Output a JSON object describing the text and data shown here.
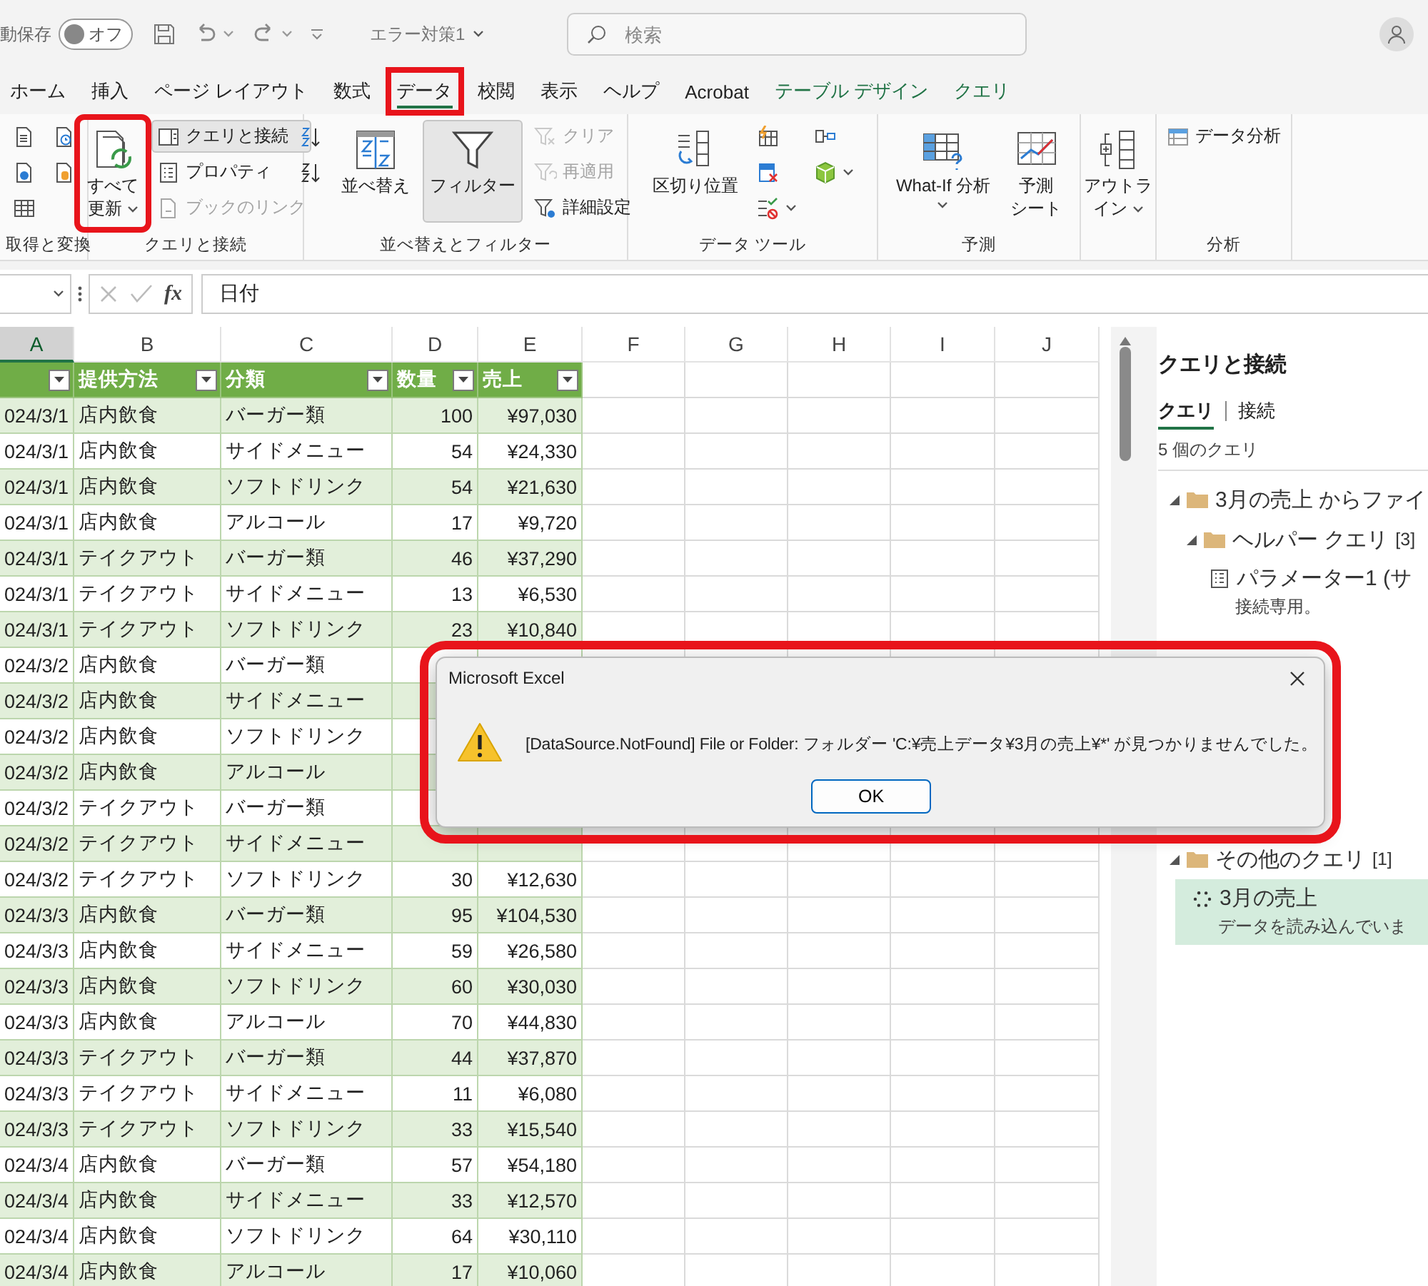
{
  "title_bar": {
    "autosave_label": "動保存",
    "autosave": {
      "on": false,
      "label": "オフ"
    },
    "file_name": "エラー対策1",
    "search": {
      "placeholder": "検索"
    }
  },
  "tabs": [
    {
      "label": "ホーム",
      "kind": "standard",
      "selected": false,
      "highlighted": false
    },
    {
      "label": "挿入",
      "kind": "standard",
      "selected": false,
      "highlighted": false
    },
    {
      "label": "ページ レイアウト",
      "kind": "standard",
      "selected": false,
      "highlighted": false
    },
    {
      "label": "数式",
      "kind": "standard",
      "selected": false,
      "highlighted": false
    },
    {
      "label": "データ",
      "kind": "standard",
      "selected": true,
      "highlighted": true
    },
    {
      "label": "校閲",
      "kind": "standard",
      "selected": false,
      "highlighted": false
    },
    {
      "label": "表示",
      "kind": "standard",
      "selected": false,
      "highlighted": false
    },
    {
      "label": "ヘルプ",
      "kind": "standard",
      "selected": false,
      "highlighted": false
    },
    {
      "label": "Acrobat",
      "kind": "standard",
      "selected": false,
      "highlighted": false
    },
    {
      "label": "テーブル デザイン",
      "kind": "contextual",
      "selected": false,
      "highlighted": false
    },
    {
      "label": "クエリ",
      "kind": "contextual",
      "selected": false,
      "highlighted": false
    }
  ],
  "ribbon": {
    "groups": [
      {
        "kind": "get",
        "label": "取得と変換",
        "buttons": [
          {
            "kind": "small",
            "disabled": false,
            "pressed": false
          },
          {
            "kind": "small",
            "disabled": false,
            "pressed": false
          },
          {
            "kind": "small",
            "disabled": false,
            "pressed": false
          },
          {
            "kind": "small",
            "disabled": false,
            "pressed": false
          },
          {
            "kind": "small",
            "disabled": false,
            "pressed": false
          }
        ]
      },
      {
        "kind": "queries",
        "label": "クエリと接続",
        "buttons": [
          {
            "kind": "large",
            "lines": [
              "すべて",
              "更新"
            ],
            "disabled": false,
            "pressed": false,
            "dropdown": true,
            "highlighted": true
          },
          {
            "kind": "small",
            "label": "クエリと接続",
            "disabled": false,
            "pressed": true
          },
          {
            "kind": "small",
            "label": "プロパティ",
            "disabled": false,
            "pressed": false
          },
          {
            "kind": "small",
            "label": "ブックのリンク",
            "disabled": true,
            "pressed": false
          }
        ]
      },
      {
        "kind": "sort",
        "label": "並べ替えとフィルター",
        "buttons": [
          {
            "kind": "small",
            "disabled": false,
            "pressed": false
          },
          {
            "kind": "small",
            "disabled": false,
            "pressed": false
          },
          {
            "kind": "large",
            "lines": [
              "並べ替え"
            ],
            "disabled": false,
            "pressed": false
          },
          {
            "kind": "large",
            "lines": [
              "フィルター"
            ],
            "disabled": false,
            "pressed": true
          },
          {
            "kind": "small",
            "label": "クリア",
            "disabled": true,
            "pressed": false
          },
          {
            "kind": "small",
            "label": "再適用",
            "disabled": true,
            "pressed": false
          },
          {
            "kind": "small",
            "label": "詳細設定",
            "disabled": false,
            "pressed": false
          }
        ]
      },
      {
        "kind": "tools",
        "label": "データ ツール",
        "buttons": [
          {
            "kind": "large",
            "lines": [
              "区切り位置"
            ],
            "disabled": false,
            "pressed": false
          },
          {
            "kind": "small",
            "disabled": false,
            "pressed": false
          },
          {
            "kind": "small",
            "disabled": false,
            "pressed": false
          },
          {
            "kind": "small",
            "disabled": false,
            "pressed": false,
            "dropdown": true
          },
          {
            "kind": "small",
            "disabled": false,
            "pressed": false
          },
          {
            "kind": "small",
            "disabled": false,
            "pressed": false,
            "dropdown": true
          }
        ]
      },
      {
        "kind": "forecast",
        "label": "予測",
        "buttons": [
          {
            "kind": "large",
            "lines": [
              "What-If 分析"
            ],
            "disabled": false,
            "pressed": false,
            "dropdown": true
          },
          {
            "kind": "large",
            "lines": [
              "予測",
              "シート"
            ],
            "disabled": false,
            "pressed": false
          }
        ]
      },
      {
        "kind": "outline",
        "buttons": [
          {
            "kind": "large",
            "lines": [
              "アウトラ",
              "イン"
            ],
            "disabled": false,
            "pressed": false,
            "dropdown": true
          }
        ]
      },
      {
        "kind": "analysis",
        "label": "分析",
        "buttons": [
          {
            "kind": "small",
            "label": "データ分析",
            "disabled": false,
            "pressed": false
          }
        ]
      }
    ]
  },
  "formula_bar": {
    "function_label": "fx",
    "value": "日付"
  },
  "sheet": {
    "column_headers": [
      {
        "letter": "A",
        "selected": true
      },
      {
        "letter": "B",
        "selected": false
      },
      {
        "letter": "C",
        "selected": false
      },
      {
        "letter": "D",
        "selected": false
      },
      {
        "letter": "E",
        "selected": false
      },
      {
        "letter": "F",
        "selected": false
      },
      {
        "letter": "G",
        "selected": false
      },
      {
        "letter": "H",
        "selected": false
      },
      {
        "letter": "I",
        "selected": false
      },
      {
        "letter": "J",
        "selected": false
      }
    ],
    "table": {
      "columns": [
        {
          "kind": "text"
        },
        {
          "label": "提供方法",
          "kind": "text"
        },
        {
          "label": "分類",
          "kind": "text"
        },
        {
          "label": "数量",
          "kind": "number"
        },
        {
          "label": "売上",
          "kind": "number"
        }
      ],
      "rows": [
        [
          "024/3/1",
          "店内飲食",
          "バーガー類",
          "100",
          "¥97,030"
        ],
        [
          "024/3/1",
          "店内飲食",
          "サイドメニュー",
          "54",
          "¥24,330"
        ],
        [
          "024/3/1",
          "店内飲食",
          "ソフトドリンク",
          "54",
          "¥21,630"
        ],
        [
          "024/3/1",
          "店内飲食",
          "アルコール",
          "17",
          "¥9,720"
        ],
        [
          "024/3/1",
          "テイクアウト",
          "バーガー類",
          "46",
          "¥37,290"
        ],
        [
          "024/3/1",
          "テイクアウト",
          "サイドメニュー",
          "13",
          "¥6,530"
        ],
        [
          "024/3/1",
          "テイクアウト",
          "ソフトドリンク",
          "23",
          "¥10,840"
        ],
        [
          "024/3/2",
          "店内飲食",
          "バーガー類"
        ],
        [
          "024/3/2",
          "店内飲食",
          "サイドメニュー"
        ],
        [
          "024/3/2",
          "店内飲食",
          "ソフトドリンク"
        ],
        [
          "024/3/2",
          "店内飲食",
          "アルコール"
        ],
        [
          "024/3/2",
          "テイクアウト",
          "バーガー類"
        ],
        [
          "024/3/2",
          "テイクアウト",
          "サイドメニュー"
        ],
        [
          "024/3/2",
          "テイクアウト",
          "ソフトドリンク",
          "30",
          "¥12,630"
        ],
        [
          "024/3/3",
          "店内飲食",
          "バーガー類",
          "95",
          "¥104,530"
        ],
        [
          "024/3/3",
          "店内飲食",
          "サイドメニュー",
          "59",
          "¥26,580"
        ],
        [
          "024/3/3",
          "店内飲食",
          "ソフトドリンク",
          "60",
          "¥30,030"
        ],
        [
          "024/3/3",
          "店内飲食",
          "アルコール",
          "70",
          "¥44,830"
        ],
        [
          "024/3/3",
          "テイクアウト",
          "バーガー類",
          "44",
          "¥37,870"
        ],
        [
          "024/3/3",
          "テイクアウト",
          "サイドメニュー",
          "11",
          "¥6,080"
        ],
        [
          "024/3/3",
          "テイクアウト",
          "ソフトドリンク",
          "33",
          "¥15,540"
        ],
        [
          "024/3/4",
          "店内飲食",
          "バーガー類",
          "57",
          "¥54,180"
        ],
        [
          "024/3/4",
          "店内飲食",
          "サイドメニュー",
          "33",
          "¥12,570"
        ],
        [
          "024/3/4",
          "店内飲食",
          "ソフトドリンク",
          "64",
          "¥30,110"
        ],
        [
          "024/3/4",
          "店内飲食",
          "アルコール",
          "17",
          "¥10,060"
        ]
      ]
    }
  },
  "query_panel": {
    "title": "クエリと接続",
    "tabs": [
      {
        "label": "クエリ",
        "selected": true
      },
      {
        "label": "接続",
        "selected": false
      }
    ],
    "count": "5 個のクエリ",
    "tree": [
      {
        "kind": "folder",
        "label": "3月の売上 からファイ",
        "expanded": true,
        "children": [
          {
            "kind": "folder",
            "label": "ヘルパー クエリ",
            "count": "[3]",
            "expanded": true,
            "children": [
              {
                "kind": "parameter",
                "label": "パラメーター1 (サ",
                "note": "接続専用。",
                "selected": false
              }
            ]
          }
        ]
      },
      {
        "kind": "folder",
        "label": "その他のクエリ",
        "count": "[1]",
        "expanded": true,
        "children": [
          {
            "kind": "loading",
            "label": "3月の売上",
            "note": "データを読み込んでいま",
            "selected": true
          }
        ]
      }
    ]
  },
  "dialog": {
    "title": "Microsoft Excel",
    "message": "[DataSource.NotFound] File or Folder: フォルダー 'C:¥売上データ¥3月の売上¥*' が見つかりませんでした。",
    "highlighted": true,
    "buttons": [
      {
        "label": "OK",
        "focused": true
      }
    ]
  }
}
